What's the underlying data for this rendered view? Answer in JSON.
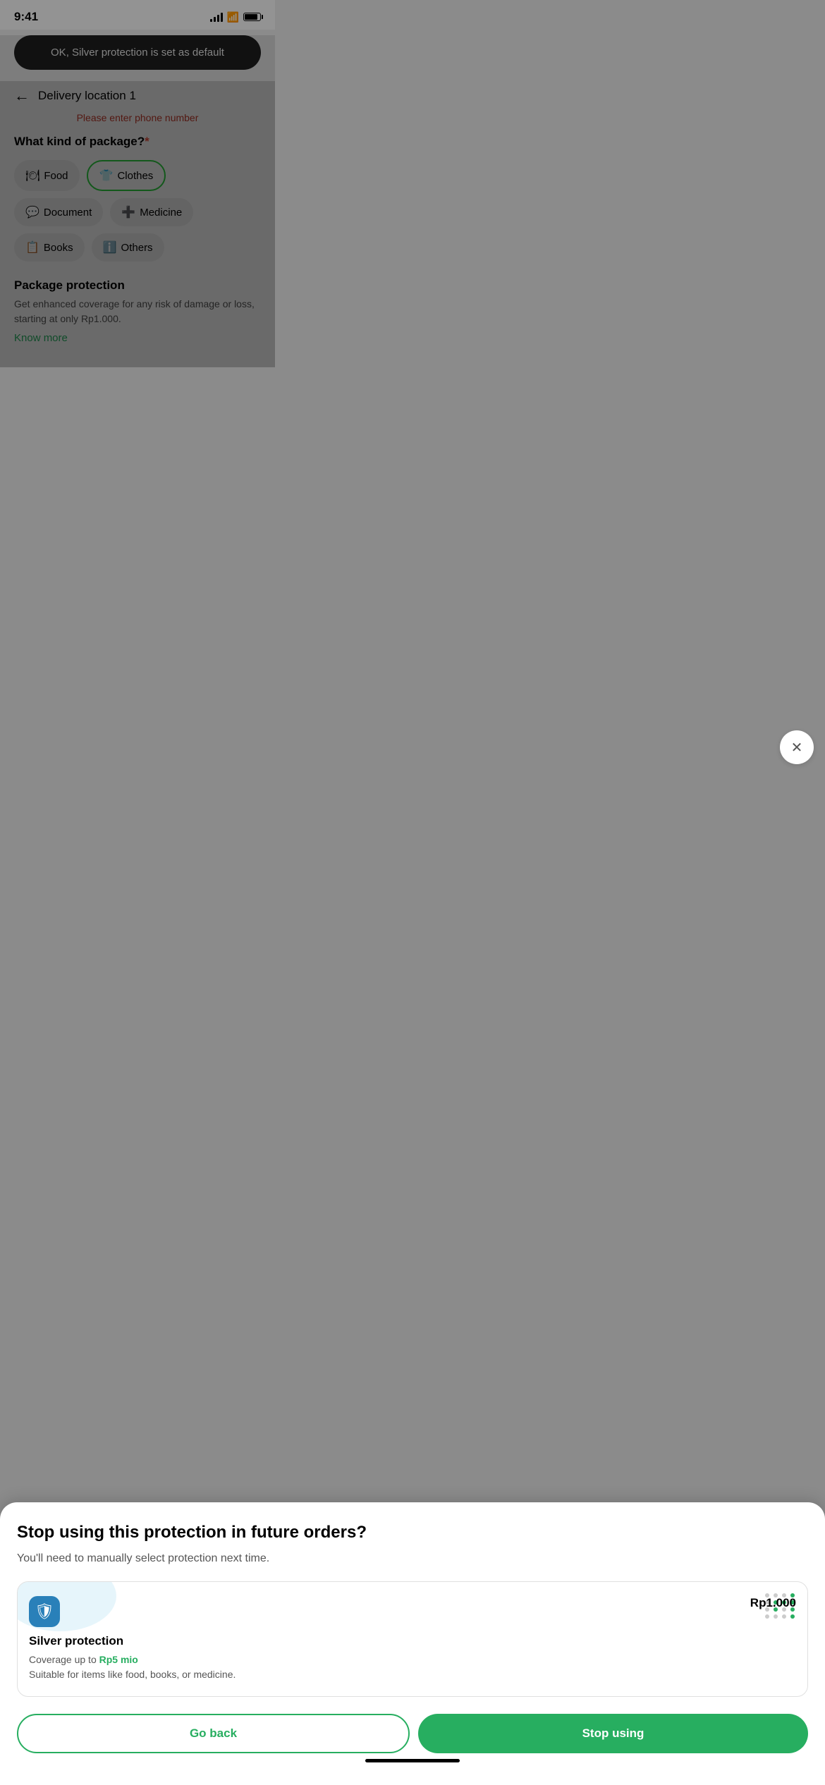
{
  "statusBar": {
    "time": "9:41",
    "battery": 85
  },
  "toast": {
    "message": "OK, Silver protection is set as default"
  },
  "nav": {
    "backLabel": "←",
    "title": "Delivery location 1"
  },
  "phoneError": "Please enter phone number",
  "packageSection": {
    "title": "What kind of package?",
    "required": "*",
    "chips": [
      {
        "id": "food",
        "label": "Food",
        "icon": "🍽",
        "selected": false
      },
      {
        "id": "clothes",
        "label": "Clothes",
        "icon": "👕",
        "selected": true
      },
      {
        "id": "document",
        "label": "Document",
        "icon": "💬",
        "selected": false
      },
      {
        "id": "medicine",
        "label": "Medicine",
        "icon": "➕",
        "selected": false
      },
      {
        "id": "books",
        "label": "Books",
        "icon": "📋",
        "selected": false
      },
      {
        "id": "others",
        "label": "Others",
        "icon": "ℹ️",
        "selected": false
      }
    ]
  },
  "protectionSection": {
    "title": "Package protection",
    "description": "Get enhanced coverage for any risk of damage or loss, starting at only Rp1.000.",
    "knowMore": "Know more"
  },
  "bottomSheet": {
    "title": "Stop using this protection in future orders?",
    "subtitle": "You'll need to manually select protection next time.",
    "card": {
      "name": "Silver protection",
      "price": "Rp1.000",
      "coverageLabel": "Coverage up to ",
      "coverageAmount": "Rp5 mio",
      "suitableFor": "Suitable for items like food, books, or medicine."
    },
    "goBackLabel": "Go back",
    "stopUsingLabel": "Stop using"
  }
}
